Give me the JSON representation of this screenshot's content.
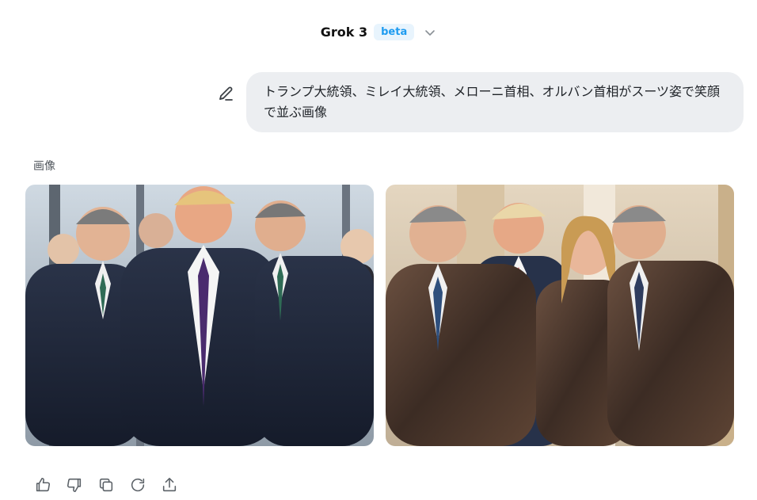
{
  "header": {
    "model_name": "Grok 3",
    "badge": "beta",
    "dropdown_icon": "chevron-down-icon"
  },
  "conversation": {
    "user_message": "トランプ大統領、ミレイ大統領、メローニ首相、オルバン首相がスーツ姿で笑顔で並ぶ画像",
    "edit_icon": "pencil-icon"
  },
  "response": {
    "section_label": "画像",
    "images": [
      {
        "alt": "generated-image-1"
      },
      {
        "alt": "generated-image-2"
      }
    ]
  },
  "actions": [
    {
      "name": "thumbs-up-icon"
    },
    {
      "name": "thumbs-down-icon"
    },
    {
      "name": "copy-icon"
    },
    {
      "name": "regenerate-icon"
    },
    {
      "name": "share-icon"
    }
  ],
  "colors": {
    "accent": "#1d9bf0",
    "bubble_bg": "#eceef1",
    "icon": "#5b6167"
  }
}
